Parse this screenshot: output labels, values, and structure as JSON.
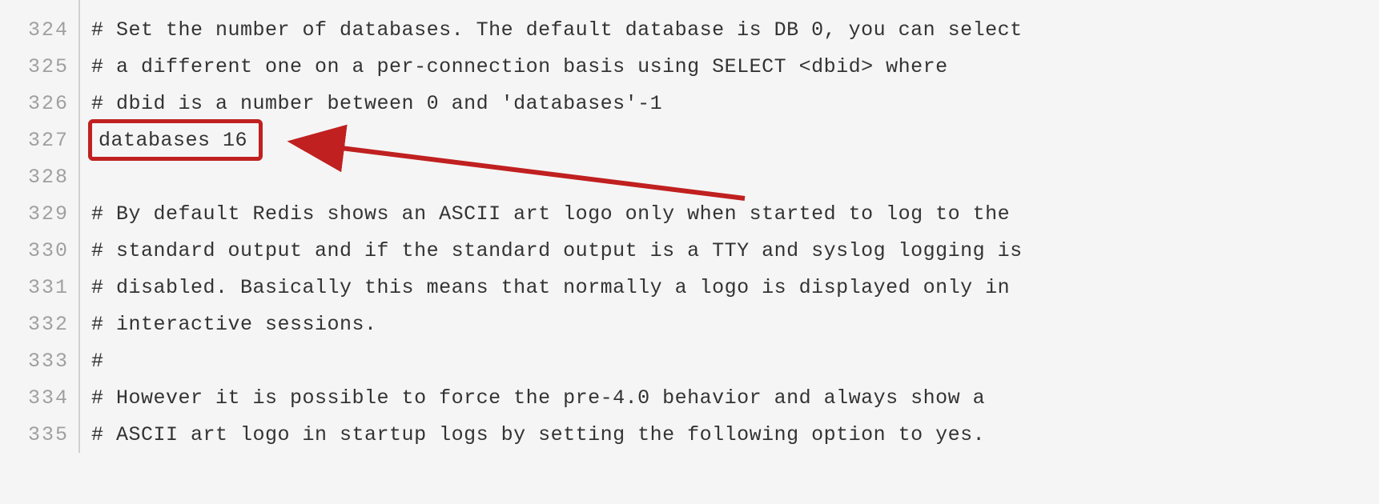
{
  "editor": {
    "lines": [
      {
        "num": "324",
        "text": "# Set the number of databases. The default database is DB 0, you can select",
        "highlight": false
      },
      {
        "num": "325",
        "text": "# a different one on a per-connection basis using SELECT <dbid> where",
        "highlight": false
      },
      {
        "num": "326",
        "text": "# dbid is a number between 0 and 'databases'-1",
        "highlight": false
      },
      {
        "num": "327",
        "text": "databases 16",
        "highlight": true
      },
      {
        "num": "328",
        "text": "",
        "highlight": false
      },
      {
        "num": "329",
        "text": "# By default Redis shows an ASCII art logo only when started to log to the",
        "highlight": false
      },
      {
        "num": "330",
        "text": "# standard output and if the standard output is a TTY and syslog logging is",
        "highlight": false
      },
      {
        "num": "331",
        "text": "# disabled. Basically this means that normally a logo is displayed only in",
        "highlight": false
      },
      {
        "num": "332",
        "text": "# interactive sessions.",
        "highlight": false
      },
      {
        "num": "333",
        "text": "#",
        "highlight": false
      },
      {
        "num": "334",
        "text": "# However it is possible to force the pre-4.0 behavior and always show a",
        "highlight": false
      },
      {
        "num": "335",
        "text": "# ASCII art logo in startup logs by setting the following option to yes.",
        "highlight": false
      }
    ],
    "annotation": {
      "highlight_color": "#c02020"
    }
  }
}
